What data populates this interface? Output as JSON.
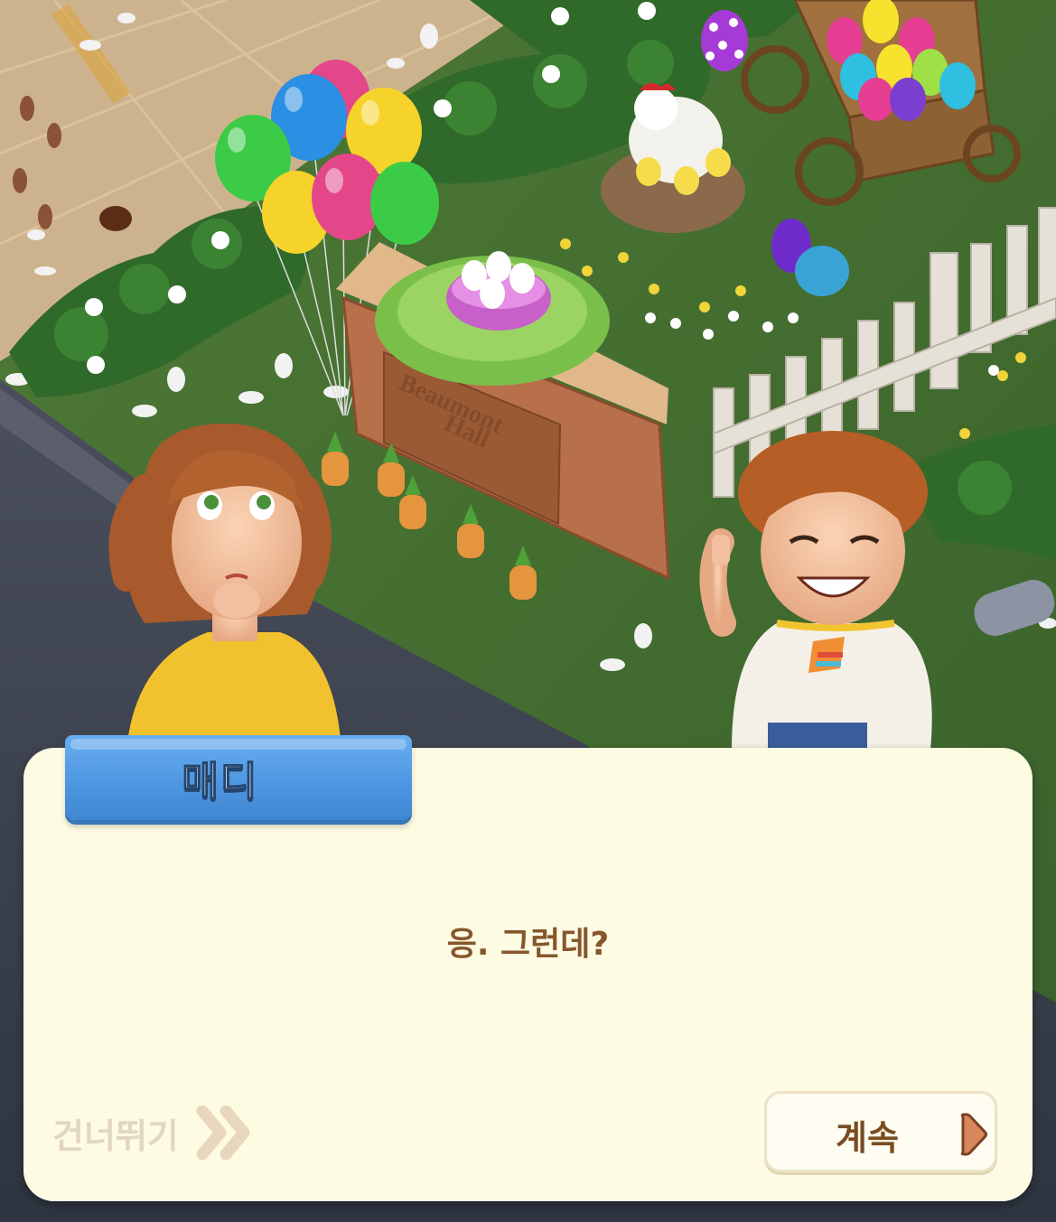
{
  "dialog": {
    "speaker_name": "매디",
    "message": "응. 그런데?",
    "skip_label": "건너뛰기",
    "continue_label": "계속"
  },
  "scene": {
    "sign_text_line1": "Beaumont",
    "sign_text_line2": "Hall"
  },
  "icons": {
    "skip": "double-chevron-right-icon",
    "continue": "play-triangle-icon"
  },
  "colors": {
    "panel": "#fefbe3",
    "name_tab": "#4f97e2",
    "message_text": "#86572c",
    "skip_text": "#e2d6bf",
    "continue_text": "#7a4c22"
  }
}
